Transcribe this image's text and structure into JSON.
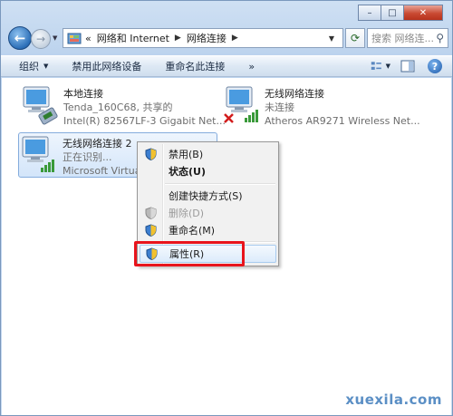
{
  "titlebar": {
    "minimize": "–",
    "maximize": "□",
    "close": "✕"
  },
  "nav": {
    "breadcrumb_lead": "«",
    "path": [
      "网络和 Internet",
      "网络连接"
    ],
    "search_placeholder": "搜索 网络连..."
  },
  "toolbar": {
    "items": [
      "组织",
      "禁用此网络设备",
      "重命名此连接"
    ],
    "overflow": "»"
  },
  "connections": [
    {
      "name": "本地连接",
      "status": "Tenda_160C68, 共享的",
      "device": "Intel(R) 82567LF-3 Gigabit Net..."
    },
    {
      "name": "无线网络连接",
      "status": "未连接",
      "device": "Atheros AR9271 Wireless Net..."
    },
    {
      "name": "无线网络连接 2",
      "status": "正在识别...",
      "device": "Microsoft Virtual"
    }
  ],
  "context_menu": {
    "items": [
      {
        "label": "禁用(B)",
        "shield": true,
        "state": "normal"
      },
      {
        "label": "状态(U)",
        "shield": false,
        "state": "bold"
      },
      {
        "label": "创建快捷方式(S)",
        "shield": false,
        "state": "normal"
      },
      {
        "label": "删除(D)",
        "shield": true,
        "state": "disabled"
      },
      {
        "label": "重命名(M)",
        "shield": true,
        "state": "normal"
      },
      {
        "label": "属性(R)",
        "shield": true,
        "state": "hover"
      }
    ]
  },
  "watermark": "xuexila.com",
  "colors": {
    "highlight": "#e8141c",
    "selection": "#d3e5fa",
    "watermark": "#5b8fc5"
  }
}
